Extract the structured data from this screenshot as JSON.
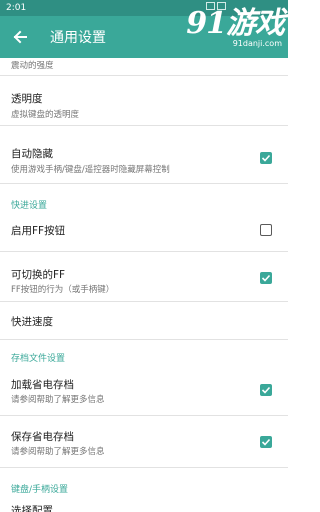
{
  "status_bar": {
    "time": "2:01"
  },
  "app_bar": {
    "title": "通用设置"
  },
  "watermark": {
    "logo": "91游戏",
    "url": "91danji.com"
  },
  "list": {
    "partial_top_subtitle": "震动的强度",
    "transparency": {
      "title": "透明度",
      "subtitle": "虚拟键盘的透明度"
    },
    "auto_hide": {
      "title": "自动隐藏",
      "subtitle": "使用游戏手柄/键盘/遥控器时隐藏屏幕控制",
      "checked": true
    },
    "section_fast_forward": "快进设置",
    "enable_ff": {
      "title": "启用FF按钮",
      "checked": false
    },
    "toggle_ff": {
      "title": "可切换的FF",
      "subtitle": "FF按钮的行为（或手柄键）",
      "checked": true
    },
    "ff_speed": {
      "title": "快进速度"
    },
    "section_save": "存档文件设置",
    "load_save": {
      "title": "加载省电存档",
      "subtitle": "请参阅帮助了解更多信息",
      "checked": true
    },
    "save_save": {
      "title": "保存省电存档",
      "subtitle": "请参阅帮助了解更多信息",
      "checked": true
    },
    "section_keyboard": "键盘/手柄设置",
    "partial_bottom_title": "选择配置"
  },
  "colors": {
    "accent": "#3aa899",
    "status_bar": "#2f8f83"
  }
}
